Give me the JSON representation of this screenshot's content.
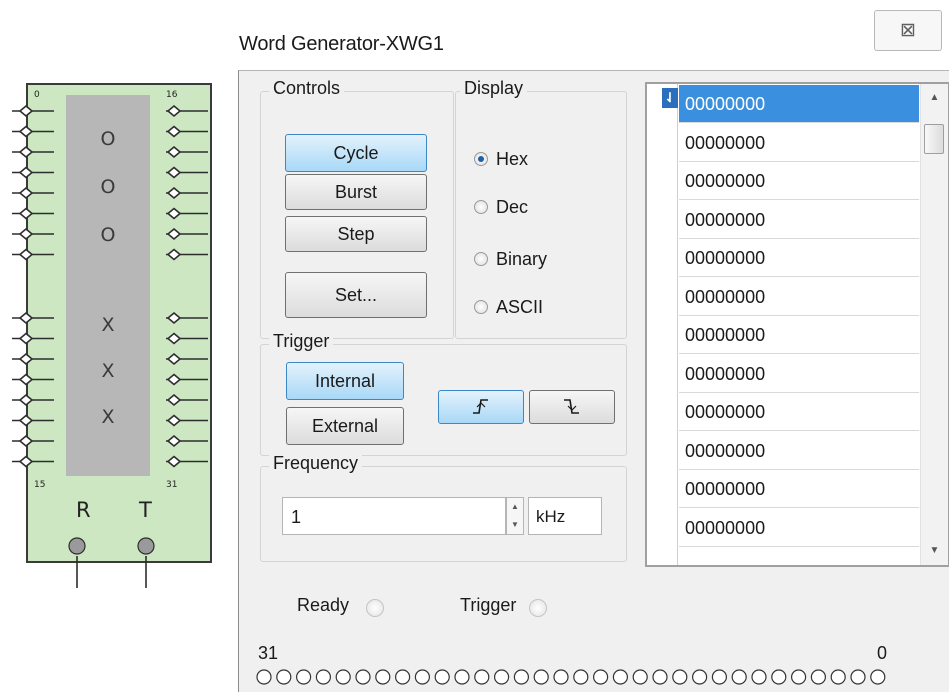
{
  "window": {
    "title": "Word Generator-XWG1",
    "close_glyph": "⊠"
  },
  "symbol": {
    "core_letters": [
      "O",
      "O",
      "O",
      "X",
      "X",
      "X"
    ],
    "pin_numbers": {
      "top_left": "0",
      "top_right": "16",
      "bottom_left": "15",
      "bottom_right": "31"
    },
    "terminals": [
      "R",
      "T"
    ]
  },
  "controls": {
    "legend": "Controls",
    "buttons": {
      "cycle": "Cycle",
      "burst": "Burst",
      "step": "Step",
      "set": "Set..."
    },
    "active": "Cycle"
  },
  "display": {
    "legend": "Display",
    "options": [
      "Hex",
      "Dec",
      "Binary",
      "ASCII"
    ],
    "selected": "Hex"
  },
  "trigger": {
    "legend": "Trigger",
    "internal_label": "Internal",
    "external_label": "External",
    "active": "Internal",
    "rising_edge_icon": "rising-edge-icon",
    "falling_edge_icon": "falling-edge-icon",
    "active_edge": "rising"
  },
  "frequency": {
    "legend": "Frequency",
    "value": "1",
    "unit": "kHz"
  },
  "status": {
    "ready_label": "Ready",
    "trigger_label": "Trigger"
  },
  "bits": {
    "high_label": "31",
    "low_label": "0",
    "count": 32
  },
  "words": [
    "00000000",
    "00000000",
    "00000000",
    "00000000",
    "00000000",
    "00000000",
    "00000000",
    "00000000",
    "00000000",
    "00000000",
    "00000000",
    "00000000"
  ],
  "selected_word_index": 0,
  "colors": {
    "accent": "#3a8fde",
    "symbol_body": "#cde7c2",
    "symbol_core": "#b7b7b7"
  }
}
